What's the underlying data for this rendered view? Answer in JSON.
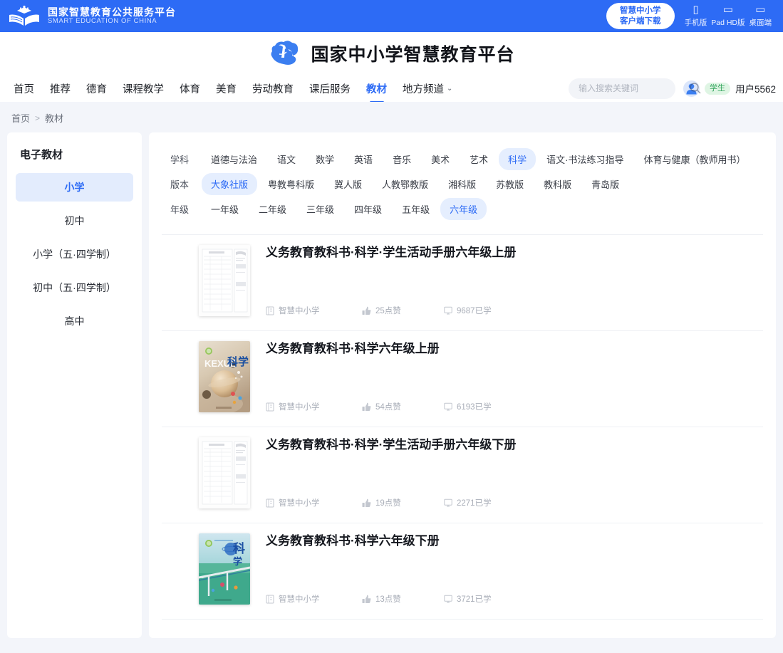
{
  "topbar": {
    "gov_name_cn": "国家智慧教育公共服务平台",
    "gov_name_en": "SMART EDUCATION OF CHINA",
    "client_btn_line1": "智慧中小学",
    "client_btn_line2": "客户端下载",
    "platforms": [
      {
        "icon": "phone-icon",
        "label": "手机版"
      },
      {
        "icon": "tablet-icon",
        "label": "Pad HD版"
      },
      {
        "icon": "desktop-icon",
        "label": "桌面端"
      }
    ]
  },
  "brand": {
    "title": "国家中小学智慧教育平台",
    "logo_icon": "cloud-logo-icon"
  },
  "nav": {
    "items": [
      {
        "label": "首页",
        "active": false,
        "caret": false
      },
      {
        "label": "推荐",
        "active": false,
        "caret": false
      },
      {
        "label": "德育",
        "active": false,
        "caret": false
      },
      {
        "label": "课程教学",
        "active": false,
        "caret": false
      },
      {
        "label": "体育",
        "active": false,
        "caret": false
      },
      {
        "label": "美育",
        "active": false,
        "caret": false
      },
      {
        "label": "劳动教育",
        "active": false,
        "caret": false
      },
      {
        "label": "课后服务",
        "active": false,
        "caret": false
      },
      {
        "label": "教材",
        "active": true,
        "caret": false
      },
      {
        "label": "地方频道",
        "active": false,
        "caret": true
      }
    ],
    "active_label": "教材",
    "accent_color": "#2d6bf5"
  },
  "search": {
    "placeholder": "输入搜索关键词",
    "value": "",
    "icon": "search-icon"
  },
  "user": {
    "avatar_icon": "user-avatar-icon",
    "role_badge": "学生",
    "name": "用户5562"
  },
  "breadcrumb": {
    "home": "首页",
    "separator": ">",
    "current": "教材"
  },
  "sidebar": {
    "title": "电子教材",
    "items": [
      {
        "label": "小学",
        "active": true
      },
      {
        "label": "初中",
        "active": false
      },
      {
        "label": "小学（五·四学制）",
        "active": false
      },
      {
        "label": "初中（五·四学制）",
        "active": false
      },
      {
        "label": "高中",
        "active": false
      }
    ]
  },
  "filters": [
    {
      "label": "学科",
      "options": [
        {
          "label": "道德与法治",
          "active": false
        },
        {
          "label": "语文",
          "active": false
        },
        {
          "label": "数学",
          "active": false
        },
        {
          "label": "英语",
          "active": false
        },
        {
          "label": "音乐",
          "active": false
        },
        {
          "label": "美术",
          "active": false
        },
        {
          "label": "艺术",
          "active": false
        },
        {
          "label": "科学",
          "active": true
        },
        {
          "label": "语文·书法练习指导",
          "active": false
        },
        {
          "label": "体育与健康（教师用书）",
          "active": false
        }
      ]
    },
    {
      "label": "版本",
      "options": [
        {
          "label": "大象社版",
          "active": true
        },
        {
          "label": "粤教粤科版",
          "active": false
        },
        {
          "label": "冀人版",
          "active": false
        },
        {
          "label": "人教鄂教版",
          "active": false
        },
        {
          "label": "湘科版",
          "active": false
        },
        {
          "label": "苏教版",
          "active": false
        },
        {
          "label": "教科版",
          "active": false
        },
        {
          "label": "青岛版",
          "active": false
        }
      ]
    },
    {
      "label": "年级",
      "options": [
        {
          "label": "一年级",
          "active": false
        },
        {
          "label": "二年级",
          "active": false
        },
        {
          "label": "三年级",
          "active": false
        },
        {
          "label": "四年级",
          "active": false
        },
        {
          "label": "五年级",
          "active": false
        },
        {
          "label": "六年级",
          "active": true
        }
      ]
    }
  ],
  "books": [
    {
      "title": "义务教育教科书·科学·学生活动手册六年级上册",
      "publisher": "智慧中小学",
      "likes": "25点赞",
      "studied": "9687已学",
      "cover_type": "worksheet"
    },
    {
      "title": "义务教育教科书·科学六年级上册",
      "publisher": "智慧中小学",
      "likes": "54点赞",
      "studied": "6193已学",
      "cover_type": "space",
      "cover_text_en": "KEXUE",
      "cover_text_cn": "科学"
    },
    {
      "title": "义务教育教科书·科学·学生活动手册六年级下册",
      "publisher": "智慧中小学",
      "likes": "19点赞",
      "studied": "2271已学",
      "cover_type": "worksheet"
    },
    {
      "title": "义务教育教科书·科学六年级下册",
      "publisher": "智慧中小学",
      "likes": "13点赞",
      "studied": "3721已学",
      "cover_type": "bridge",
      "cover_text_cn": "科学"
    }
  ],
  "icons": {
    "publisher": "book-icon",
    "likes": "thumbs-up-icon",
    "studied": "monitor-icon"
  }
}
